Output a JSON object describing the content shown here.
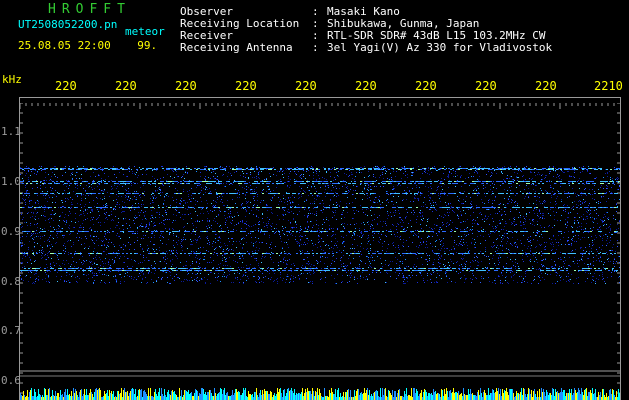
{
  "header": {
    "app_name": "HROFFT",
    "file_name": "UT2508052200.pn",
    "meteor_label": "meteor",
    "date_time": "25.08.05 22:00",
    "count": "99."
  },
  "info": [
    {
      "label": "Observer",
      "sep": ":",
      "value": "Masaki Kano"
    },
    {
      "label": "Receiving Location",
      "sep": ":",
      "value": "Shibukawa, Gunma, Japan"
    },
    {
      "label": "Receiver",
      "sep": ":",
      "value": "RTL-SDR SDR# 43dB L15 103.2MHz CW"
    },
    {
      "label": "Receiving Antenna",
      "sep": ":",
      "value": "3el Yagi(V) Az 330 for Vladivostok"
    }
  ],
  "axis": {
    "freq_unit": "kHz",
    "time_ticks": [
      "220",
      "220",
      "220",
      "220",
      "220",
      "220",
      "220",
      "220",
      "220",
      "2210"
    ],
    "freq_ticks": [
      "1.1",
      "1.0",
      "0.9",
      "0.8",
      "0.7",
      "0.6"
    ]
  },
  "colors": {
    "title_green": "#33cc33",
    "text_cyan": "#00ffff",
    "tick_yellow": "#ffff00",
    "label_white": "#ffffff",
    "axis_grey": "#9a9a9a",
    "signal_blue": "#1a2fd8"
  }
}
